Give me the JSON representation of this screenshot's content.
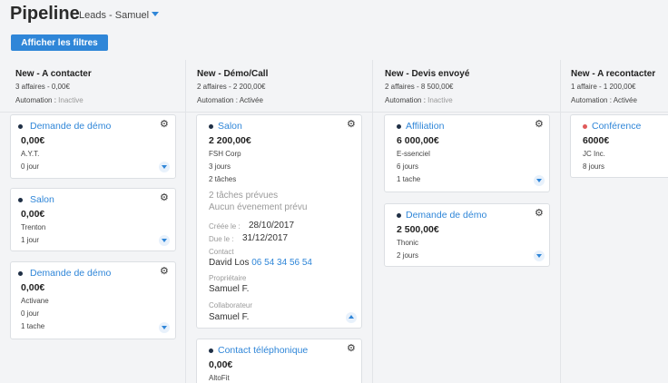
{
  "header": {
    "title": "Pipeline",
    "subtitle": "Leads - Samuel",
    "filters_label": "Afficher les filtres"
  },
  "colors": {
    "accent": "#2f86d8",
    "dot_dark": "#1f2f45",
    "dot_red": "#e05a5a"
  },
  "columns": [
    {
      "name": "New - A contacter",
      "count": "3 affaires - 0,00€",
      "auto_label": "Automation :",
      "auto_state": "Inactive",
      "cards": [
        {
          "name": "Demande de démo",
          "amount": "0,00€",
          "company": "A.Y.T.",
          "meta": "0 jour"
        },
        {
          "name": "Salon",
          "amount": "0,00€",
          "company": "Trenton",
          "meta": "1 jour"
        },
        {
          "name": "Demande de démo",
          "amount": "0,00€",
          "company": "Activane",
          "meta": "0 jour",
          "tasks": "1 tache"
        }
      ]
    },
    {
      "name": "New - Démo/Call",
      "count": "2 affaires - 2 200,00€",
      "auto_label": "Automation :",
      "auto_state": "Activée",
      "cards": [
        {
          "name": "Salon",
          "amount": "2 200,00€",
          "company": "FSH Corp",
          "meta": "3 jours",
          "tasks": "2 tâches",
          "planned": "2 tâches prévues",
          "events": "Aucun évenement prévu",
          "created_label": "Créée le :",
          "created": "28/10/2017",
          "due_label": "Due le :",
          "due": "31/12/2017",
          "contact_label": "Contact",
          "contact": "David Los",
          "phone": "06 54 34 56 54",
          "owner_label": "Propriétaire",
          "owner": "Samuel F.",
          "collab_label": "Collaborateur",
          "collab": "Samuel F."
        },
        {
          "name": "Contact téléphonique",
          "amount": "0,00€",
          "company": "AltoFit"
        }
      ]
    },
    {
      "name": "New - Devis envoyé",
      "count": "2 affaires - 8 500,00€",
      "auto_label": "Automation :",
      "auto_state": "Inactive",
      "cards": [
        {
          "name": "Affiliation",
          "amount": "6 000,00€",
          "company": "E-ssenciel",
          "meta": "6 jours",
          "tasks": "1 tache"
        },
        {
          "name": "Demande de démo",
          "amount": "2 500,00€",
          "company": "Thonic",
          "meta": "2 jours"
        }
      ]
    },
    {
      "name": "New - A recontacter",
      "count": "1 affaire - 1 200,00€",
      "auto_label": "Automation :",
      "auto_state": "Activée",
      "cards": [
        {
          "name": "Conférence",
          "amount": "6000€",
          "company": "JC Inc.",
          "meta": "8 jours"
        }
      ]
    }
  ],
  "icons": {
    "gear": "gear-icon",
    "chevron": "chevron-down-icon",
    "caret": "caret-down-icon"
  }
}
